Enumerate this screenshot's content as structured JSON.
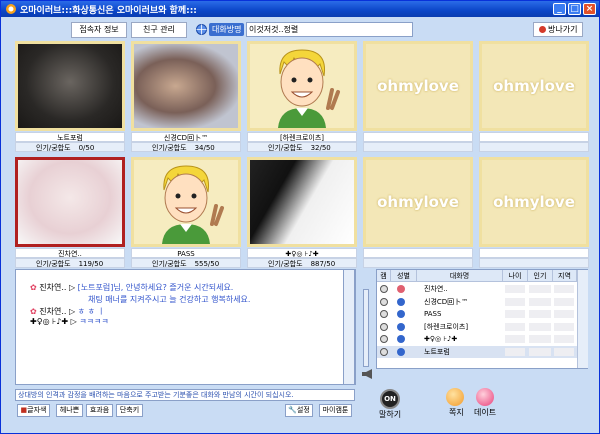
{
  "window": {
    "title": "오마이러브:::화상통신은 오마이러브와 함께:::",
    "buttons": [
      "_",
      "□",
      "×"
    ]
  },
  "toolbar": {
    "btn_profile": "접속자 정보",
    "btn_friends": "친구 관리",
    "room_label": "대화방명",
    "room_name": "이것저것..정렬",
    "exit": "방나가기"
  },
  "cams": [
    {
      "name": "노트포럼",
      "pop": "인기/궁합도",
      "count": "0/50",
      "kind": "photo-dark"
    },
    {
      "name": "신경CD回卜™",
      "pop": "인기/궁합도",
      "count": "34/50",
      "kind": "photo-blur"
    },
    {
      "name": "[하렌크로이츠]",
      "pop": "인기/궁합도",
      "count": "32/50",
      "kind": "cartoon"
    },
    {
      "name": "",
      "pop": "",
      "count": "",
      "kind": "ohmylove"
    },
    {
      "name": "",
      "pop": "",
      "count": "",
      "kind": "ohmylove"
    },
    {
      "name": "진차연..",
      "pop": "인기/궁합도",
      "count": "119/50",
      "kind": "photo-light"
    },
    {
      "name": "PASS",
      "pop": "인기/궁합도",
      "count": "555/50",
      "kind": "cartoon"
    },
    {
      "name": "✚♀◎ ⊦♪✚",
      "pop": "인기/궁합도",
      "count": "887/50",
      "kind": "photo-bw"
    },
    {
      "name": "",
      "pop": "",
      "count": "",
      "kind": "ohmylove"
    },
    {
      "name": "",
      "pop": "",
      "count": "",
      "kind": "ohmylove"
    }
  ],
  "placeholder_brand": "ohmylove",
  "chat": {
    "l1_name": "진차연..",
    "l1_text": "[노트포럼]님, 안녕하세요? 즐거운 시간되세요.",
    "l2_text": "채팅 매너를 지켜주시고 늘 건강하고 행복하세요.",
    "l3_name": "진차연..",
    "l3_text": "ㅎ ㅎ ㅣ",
    "l4_name": "✚♀◎ ⊦♪✚",
    "l4_text": "ㅋㅋㅋㅋ"
  },
  "users": {
    "headers": [
      "캠",
      "성별",
      "대화명",
      "나이",
      "인기",
      "지역"
    ],
    "rows": [
      {
        "name": "진차연..",
        "gender": "f"
      },
      {
        "name": "신경CD回卜™",
        "gender": "m"
      },
      {
        "name": "PASS",
        "gender": "m"
      },
      {
        "name": "[하렌크로이츠]",
        "gender": "m"
      },
      {
        "name": "✚♀◎ ⊦♪✚",
        "gender": "m"
      },
      {
        "name": "노트포럼",
        "gender": "m"
      }
    ]
  },
  "notice": "상대방의 인격과 감정을 배려하는 마음으로 주고받는 기분좋은 대화와 만남의 시간이 되십시오.",
  "bottom": {
    "font": "글자색",
    "emoticon": "헤나쁜",
    "effect": "효과음",
    "shortcut": "단축키",
    "settings": "설정",
    "myinfo": "마이캠툰",
    "talk": "말하기",
    "on": "ON",
    "note": "쪽지",
    "date": "데이트"
  },
  "colors": {
    "accent": "#0b46c8",
    "bg": "#c9dcf4",
    "notice_text": "#2a4fae"
  }
}
